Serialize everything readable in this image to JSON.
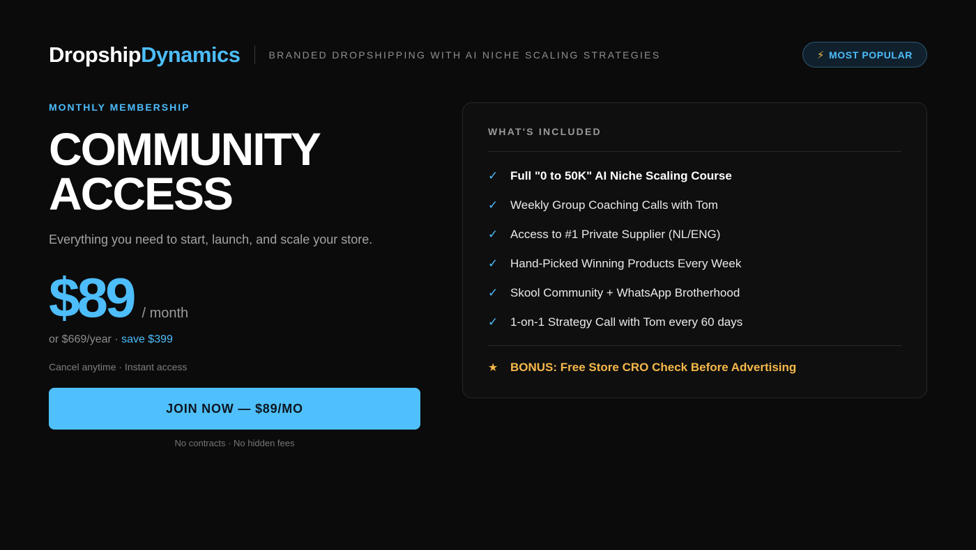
{
  "header": {
    "brand_primary": "Dropship",
    "brand_accent": "Dynamics",
    "tagline": "BRANDED DROPSHIPPING WITH AI NICHE SCALING STRATEGIES",
    "badge_icon": "⚡",
    "badge_label": "MOST POPULAR"
  },
  "plan": {
    "eyebrow": "MONTHLY MEMBERSHIP",
    "title_line1": "COMMUNITY",
    "title_line2": "ACCESS",
    "subtitle": "Everything you need to start, launch, and scale your store.",
    "price": "$89",
    "period": "/ month",
    "yearly_text": "or $669/year · ",
    "yearly_save": "save $399",
    "terms": "Cancel anytime · Instant access",
    "cta_label": "JOIN NOW — $89/MO",
    "fine_print": "No contracts · No hidden fees"
  },
  "included": {
    "title": "WHAT'S INCLUDED",
    "check_icon": "✓",
    "items": [
      "Full \"0 to 50K\" AI Niche Scaling Course",
      "Weekly Group Coaching Calls with Tom",
      "Access to #1 Private Supplier (NL/ENG)",
      "Hand-Picked Winning Products Every Week",
      "Skool Community + WhatsApp Brotherhood",
      "1-on-1 Strategy Call with Tom every 60 days"
    ],
    "bonus_icon": "★",
    "bonus": "BONUS: Free Store CRO Check Before Advertising"
  },
  "colors": {
    "background": "#0b0b0b",
    "accent": "#4dbdfb",
    "bonus": "#f5b84a"
  }
}
